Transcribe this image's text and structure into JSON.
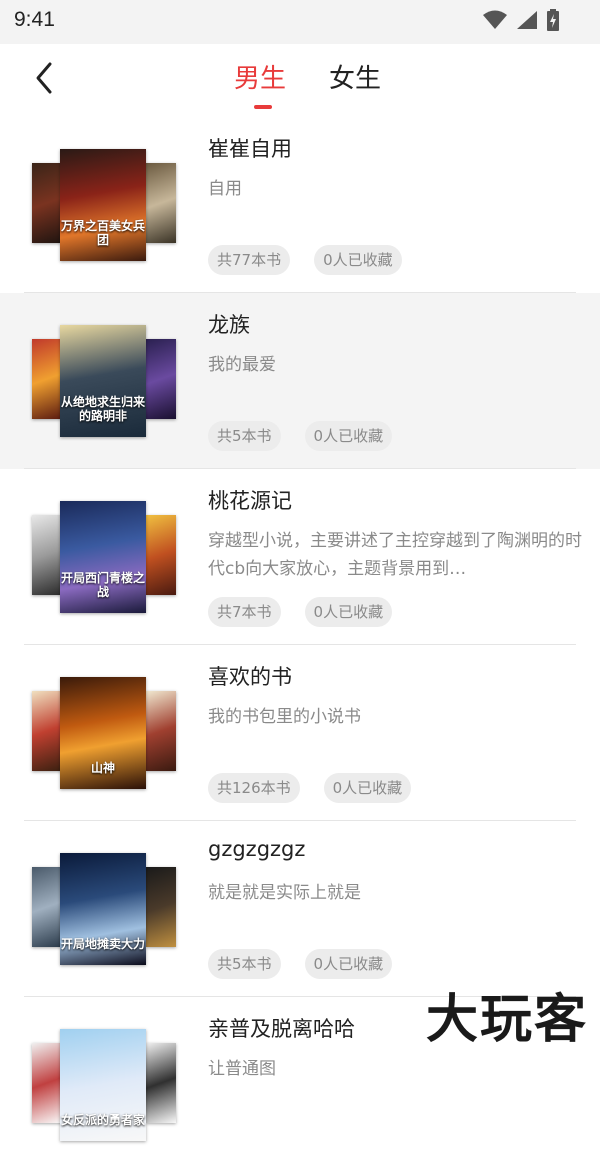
{
  "status_bar": {
    "time": "9:41",
    "icons": [
      "wifi-icon",
      "signal-icon",
      "battery-icon"
    ]
  },
  "header": {
    "back_icon": "chevron-left-icon",
    "tabs": [
      {
        "label": "男生",
        "active": true
      },
      {
        "label": "女生",
        "active": false
      }
    ],
    "accent_color": "#e83b3b"
  },
  "book_lists": [
    {
      "title": "崔崔自用",
      "description": "自用",
      "book_count": "共77本书",
      "favorites": "0人已收藏",
      "cover_caption": "万界之百美女兵团"
    },
    {
      "title": "龙族",
      "description": "我的最爱",
      "book_count": "共5本书",
      "favorites": "0人已收藏",
      "cover_caption": "从绝地求生归来的路明非"
    },
    {
      "title": "桃花源记",
      "description": "穿越型小说，主要讲述了主控穿越到了陶渊明的时代cb向大家放心，主题背景用到…",
      "book_count": "共7本书",
      "favorites": "0人已收藏",
      "cover_caption": "开局西门青楼之战"
    },
    {
      "title": "喜欢的书",
      "description": "我的书包里的小说书",
      "book_count": "共126本书",
      "favorites": "0人已收藏",
      "cover_caption": "山神"
    },
    {
      "title": "gzgzgzgz",
      "description": "就是就是实际上就是",
      "book_count": "共5本书",
      "favorites": "0人已收藏",
      "cover_caption": "开局地摊卖大力"
    },
    {
      "title": "亲普及脱离哈哈",
      "description": "让普通图",
      "book_count": "",
      "favorites": "",
      "cover_caption": "女反派的勇者家"
    }
  ],
  "watermark": "大玩客"
}
